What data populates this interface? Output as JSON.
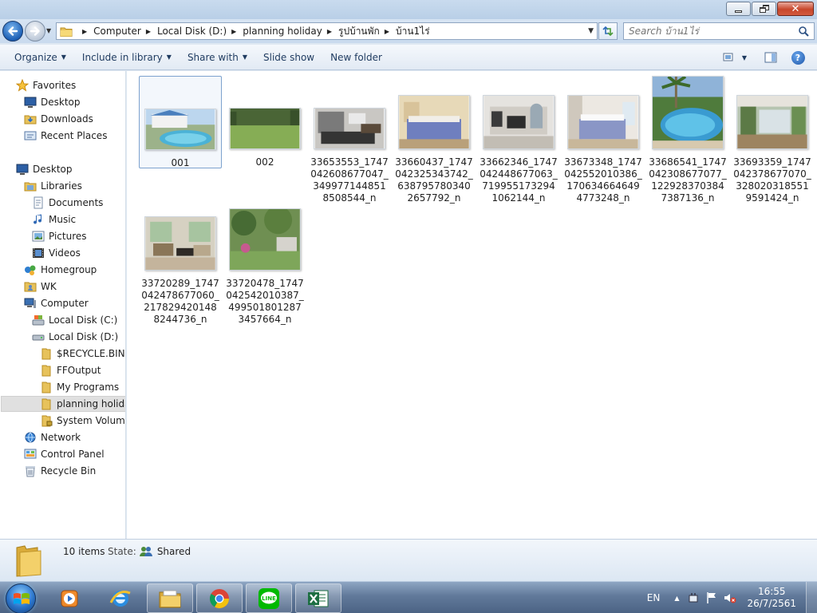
{
  "window": {
    "controls": {
      "minimize": "minimize",
      "maximize": "restore",
      "close": "close"
    }
  },
  "address": {
    "crumbs": [
      "Computer",
      "Local Disk (D:)",
      "planning holiday",
      "รูปบ้านพัก",
      "บ้าน1ไร่"
    ]
  },
  "search": {
    "placeholder": "Search บ้าน1ไร่"
  },
  "toolbar": {
    "organize": "Organize",
    "include_in_library": "Include in library",
    "share_with": "Share with",
    "slide_show": "Slide show",
    "new_folder": "New folder",
    "icons": [
      "views-icon",
      "preview-pane-icon",
      "help-icon"
    ]
  },
  "nav": {
    "favorites": "Favorites",
    "desktop_fav": "Desktop",
    "downloads": "Downloads",
    "recent_places": "Recent Places",
    "desktop": "Desktop",
    "libraries": "Libraries",
    "documents": "Documents",
    "music": "Music",
    "pictures": "Pictures",
    "videos": "Videos",
    "homegroup": "Homegroup",
    "wk": "WK",
    "computer": "Computer",
    "local_c": "Local Disk (C:)",
    "local_d": "Local Disk (D:)",
    "recycle_bin_folder": "$RECYCLE.BIN",
    "ffoutput": "FFOutput",
    "my_programs": "My Programs",
    "planning_holiday": "planning holiday",
    "system_volume": "System Volume Information",
    "network": "Network",
    "control_panel": "Control Panel",
    "recycle_bin": "Recycle Bin"
  },
  "files": [
    {
      "name": "001",
      "kind": "pool"
    },
    {
      "name": "002",
      "kind": "lawn"
    },
    {
      "name": "33653553_1747042608677047_3499771448518508544_n",
      "kind": "kitchen"
    },
    {
      "name": "33660437_1747042325343742_6387957803402657792_n",
      "kind": "bedroom"
    },
    {
      "name": "33662346_1747042448677063_7199551732941062144_n",
      "kind": "hall"
    },
    {
      "name": "33673348_1747042552010386_1706346646494773248_n",
      "kind": "bedroom2"
    },
    {
      "name": "33686541_1747042308677077_1229283703847387136_n",
      "kind": "poolpalm"
    },
    {
      "name": "33693359_1747042378677070_3280203185519591424_n",
      "kind": "terrace"
    },
    {
      "name": "33720289_1747042478677060_2178294201488244736_n",
      "kind": "livingroom"
    },
    {
      "name": "33720478_1747042542010387_4995018012873457664_n",
      "kind": "garden"
    }
  ],
  "details": {
    "count": "10 items",
    "state_label": "State:",
    "state_value": "Shared"
  },
  "taskbar": {
    "apps": [
      "windows-media-player",
      "internet-explorer",
      "windows-explorer",
      "google-chrome",
      "line",
      "microsoft-excel"
    ],
    "lang": "EN",
    "time": "16:55",
    "date": "26/7/2561"
  }
}
